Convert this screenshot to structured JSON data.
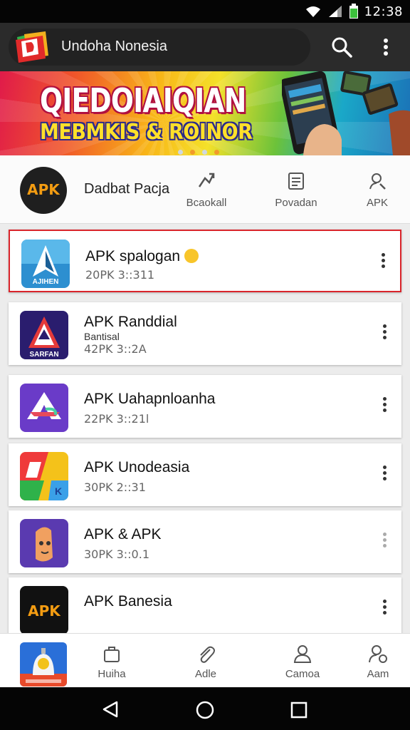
{
  "status_bar": {
    "time": "12:38"
  },
  "app_bar": {
    "title": "Undoha Nonesia"
  },
  "banner": {
    "headline": "QIEDOIAIQIAN",
    "subheadline": "MEBMKIS & ROINOR"
  },
  "header": {
    "badge_text": "APK",
    "name": "Dadbat Pacja",
    "actions": [
      {
        "label": "Bcaokall",
        "icon": "graph-icon"
      },
      {
        "label": "Povadan",
        "icon": "document-icon"
      },
      {
        "label": "APK",
        "icon": "user-search-icon"
      }
    ]
  },
  "apps": [
    {
      "title": "APK spalogan",
      "subtitle": "",
      "meta": "20PK 3::311",
      "icon": "compass-a-icon",
      "icon_text": "AJIHEN",
      "selected": true
    },
    {
      "title": "APK Randdial",
      "subtitle": "Bantisal",
      "meta": "42PK 3::2A",
      "icon": "triangle-a-icon",
      "icon_text": "SARFAN",
      "selected": false
    },
    {
      "title": "APK Uahapnloanha",
      "subtitle": "",
      "meta": "22PK 3::21l",
      "icon": "arrow-a-icon",
      "icon_text": "",
      "selected": false
    },
    {
      "title": "APK Unodeasia",
      "subtitle": "",
      "meta": "30PK 2::31",
      "icon": "colorful-k-icon",
      "icon_text": "",
      "selected": false
    },
    {
      "title": "APK & APK",
      "subtitle": "",
      "meta": "30PK 3::0.1",
      "icon": "character-face-icon",
      "icon_text": "",
      "selected": false
    },
    {
      "title": "APK Banesia",
      "subtitle": "",
      "meta": "",
      "icon": "apk-logo-icon",
      "icon_text": "APK",
      "selected": false
    }
  ],
  "bottom_nav": [
    {
      "label": "Huiha",
      "icon": "briefcase-icon"
    },
    {
      "label": "Adle",
      "icon": "paperclip-icon"
    },
    {
      "label": "Camoa",
      "icon": "person-icon"
    },
    {
      "label": "Aam",
      "icon": "person-add-icon"
    }
  ],
  "colors": {
    "app_bar": "#2b2b2b",
    "selected_border": "#d9252b",
    "accent_orange": "#f39c12"
  }
}
